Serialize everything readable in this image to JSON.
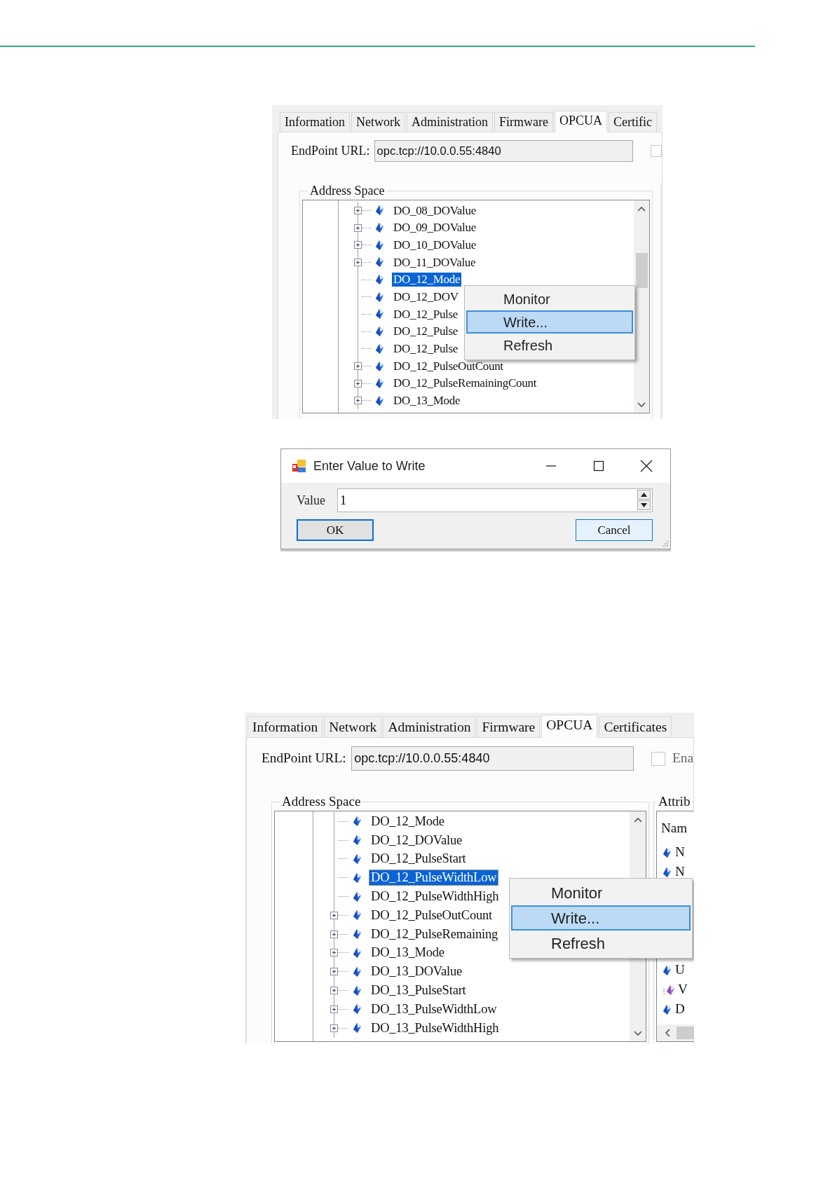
{
  "screens": [
    {
      "tabs": [
        {
          "label": "Information",
          "selected": false
        },
        {
          "label": "Network",
          "selected": false
        },
        {
          "label": "Administration",
          "selected": false
        },
        {
          "label": "Firmware",
          "selected": false
        },
        {
          "label": "OPCUA",
          "selected": true
        },
        {
          "label": "Certific",
          "selected": false
        }
      ],
      "endpoint": {
        "label": "EndPoint URL:",
        "value": "opc.tcp://10.0.0.55:4840"
      },
      "enable": {
        "checked": false
      },
      "address_space": {
        "title": "Address Space",
        "items": [
          {
            "label": "DO_08_DOValue",
            "expandable": true,
            "selected": false
          },
          {
            "label": "DO_09_DOValue",
            "expandable": true,
            "selected": false
          },
          {
            "label": "DO_10_DOValue",
            "expandable": true,
            "selected": false
          },
          {
            "label": "DO_11_DOValue",
            "expandable": true,
            "selected": false
          },
          {
            "label": "DO_12_Mode",
            "expandable": false,
            "selected": true
          },
          {
            "label": "DO_12_DOV",
            "expandable": false,
            "selected": false
          },
          {
            "label": "DO_12_Pulse",
            "expandable": false,
            "selected": false
          },
          {
            "label": "DO_12_Pulse",
            "expandable": false,
            "selected": false
          },
          {
            "label": "DO_12_Pulse",
            "expandable": false,
            "selected": false
          },
          {
            "label": "DO_12_PulseOutCount",
            "expandable": true,
            "selected": false
          },
          {
            "label": "DO_12_PulseRemainingCount",
            "expandable": true,
            "selected": false
          },
          {
            "label": "DO_13_Mode",
            "expandable": true,
            "selected": false
          }
        ]
      },
      "context_menu": [
        {
          "label": "Monitor",
          "selected": false
        },
        {
          "label": "Write...",
          "selected": true
        },
        {
          "label": "Refresh",
          "selected": false
        }
      ]
    },
    {
      "tabs": [
        {
          "label": "Information",
          "selected": false
        },
        {
          "label": "Network",
          "selected": false
        },
        {
          "label": "Administration",
          "selected": false
        },
        {
          "label": "Firmware",
          "selected": false
        },
        {
          "label": "OPCUA",
          "selected": true
        },
        {
          "label": "Certificates",
          "selected": false
        }
      ],
      "endpoint": {
        "label": "EndPoint URL:",
        "value": "opc.tcp://10.0.0.55:4840"
      },
      "enable": {
        "checked": false,
        "label": "Ena"
      },
      "address_space": {
        "title": "Address Space",
        "items": [
          {
            "label": "DO_12_Mode",
            "expandable": false,
            "selected": false
          },
          {
            "label": "DO_12_DOValue",
            "expandable": false,
            "selected": false
          },
          {
            "label": "DO_12_PulseStart",
            "expandable": false,
            "selected": false
          },
          {
            "label": "DO_12_PulseWidthLow",
            "expandable": false,
            "selected": true
          },
          {
            "label": "DO_12_PulseWidthHigh",
            "expandable": false,
            "selected": false
          },
          {
            "label": "DO_12_PulseOutCount",
            "expandable": true,
            "selected": false
          },
          {
            "label": "DO_12_PulseRemaining",
            "expandable": true,
            "selected": false
          },
          {
            "label": "DO_13_Mode",
            "expandable": true,
            "selected": false
          },
          {
            "label": "DO_13_DOValue",
            "expandable": true,
            "selected": false
          },
          {
            "label": "DO_13_PulseStart",
            "expandable": true,
            "selected": false
          },
          {
            "label": "DO_13_PulseWidthLow",
            "expandable": true,
            "selected": false
          },
          {
            "label": "DO_13_PulseWidthHigh",
            "expandable": true,
            "selected": false
          }
        ]
      },
      "attributes": {
        "title": "Attrib",
        "header": "Nam",
        "rows_upper": [
          {
            "label": "N",
            "kind": "node"
          },
          {
            "label": "N",
            "kind": "node"
          }
        ],
        "rows_lower": [
          {
            "label": "U",
            "kind": "node"
          },
          {
            "label": "V",
            "kind": "variable"
          },
          {
            "label": "D",
            "kind": "node"
          }
        ]
      },
      "context_menu": [
        {
          "label": "Monitor",
          "selected": false
        },
        {
          "label": "Write...",
          "selected": true
        },
        {
          "label": "Refresh",
          "selected": false
        }
      ]
    }
  ],
  "dialog": {
    "title": "Enter Value to Write",
    "value_label": "Value",
    "value": "1",
    "buttons": [
      {
        "label": "OK",
        "focused": true
      },
      {
        "label": "Cancel",
        "focused": false
      }
    ]
  }
}
